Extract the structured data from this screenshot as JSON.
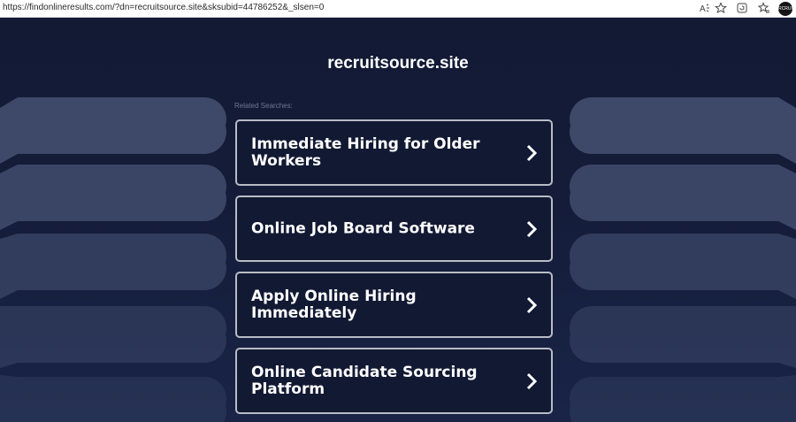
{
  "browser": {
    "url": "https://findonlineresults.com/?dn=recruitsource.site&sksubid=44786252&_slsen=0",
    "read_aloud_icon": "read-aloud-icon",
    "favorite_icon": "star-icon",
    "refresh_icon": "refresh-icon",
    "favorites_icon": "favorites-icon",
    "profile_label": "RCRUI"
  },
  "page": {
    "site_title": "recruitsource.site",
    "related_label": "Related Searches:",
    "results": [
      {
        "label": "Immediate Hiring for Older Workers"
      },
      {
        "label": "Online Job Board Software"
      },
      {
        "label": "Apply Online Hiring Immediately"
      },
      {
        "label": "Online Candidate Sourcing Platform"
      }
    ]
  },
  "colors": {
    "background": "#121933",
    "card_border": "#b8bcc6",
    "text": "#ffffff",
    "muted_text": "#6f7891",
    "decoration": "#4b5678"
  }
}
